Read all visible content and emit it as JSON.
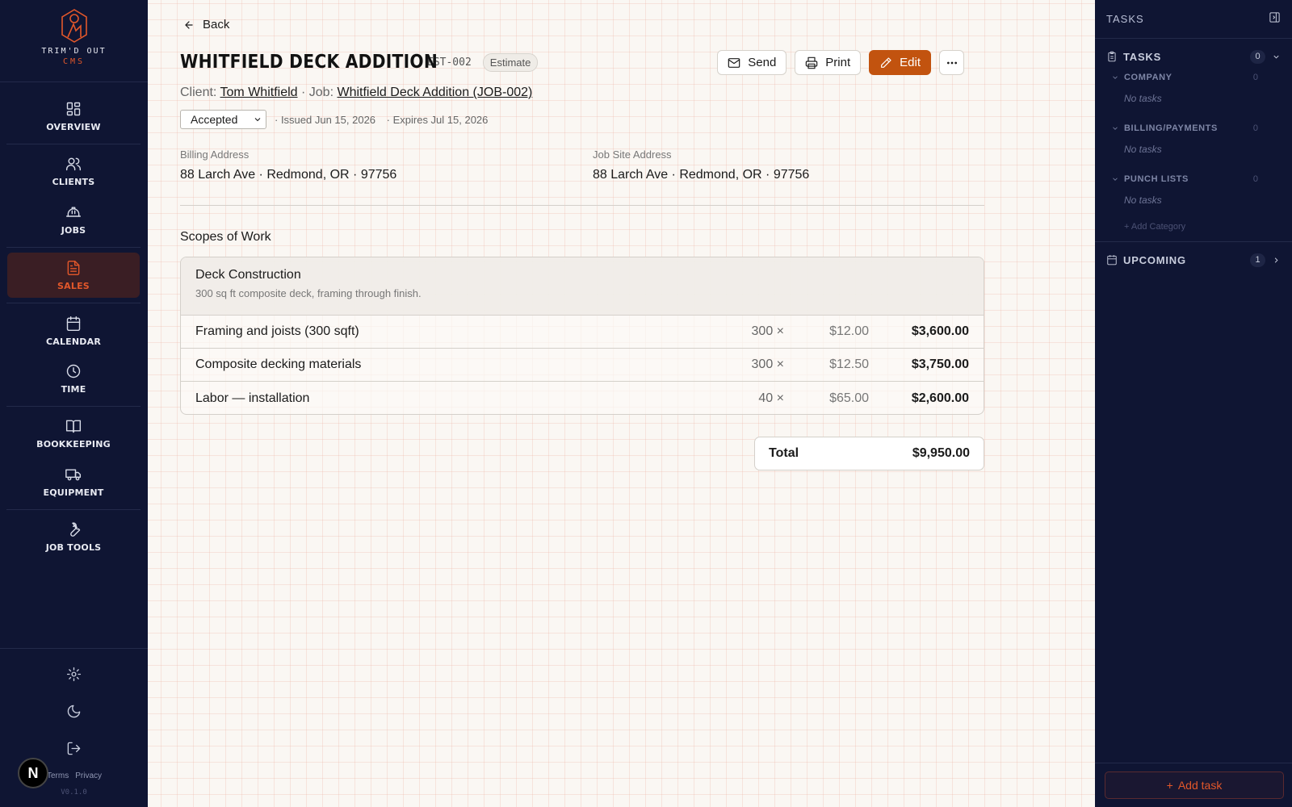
{
  "brand": {
    "name": "TRIM'D OUT",
    "sub": "CMS"
  },
  "nav": [
    {
      "id": "overview",
      "label": "OVERVIEW",
      "icon": "dashboard-icon"
    },
    {
      "id": "clients",
      "label": "CLIENTS",
      "icon": "users-icon"
    },
    {
      "id": "jobs",
      "label": "JOBS",
      "icon": "hard-hat-icon"
    },
    {
      "id": "sales",
      "label": "SALES",
      "icon": "document-icon",
      "active": true
    },
    {
      "id": "calendar",
      "label": "CALENDAR",
      "icon": "calendar-icon"
    },
    {
      "id": "time",
      "label": "TIME",
      "icon": "clock-icon"
    },
    {
      "id": "bookkeeping",
      "label": "BOOKKEEPING",
      "icon": "book-icon"
    },
    {
      "id": "equipment",
      "label": "EQUIPMENT",
      "icon": "truck-icon"
    },
    {
      "id": "jobtools",
      "label": "JOB TOOLS",
      "icon": "wrench-icon"
    }
  ],
  "footer": {
    "terms": "Terms",
    "privacy": "Privacy",
    "version": "V0.1.0",
    "badge": "N"
  },
  "header": {
    "back": "Back",
    "title": "WHITFIELD DECK ADDITION",
    "estimate_id": "EST-002",
    "type_badge": "Estimate",
    "actions": {
      "send": "Send",
      "print": "Print",
      "edit": "Edit"
    },
    "client_label": "Client:",
    "client_name": "Tom Whitfield",
    "job_sep": " · Job:",
    "job_name": "Whitfield Deck Addition (JOB-002)",
    "status": "Accepted",
    "issued": "· Issued Jun 15, 2026",
    "expires": "· Expires Jul 15, 2026"
  },
  "addresses": {
    "billing_label": "Billing Address",
    "billing_value": "88 Larch Ave · Redmond, OR · 97756",
    "site_label": "Job Site Address",
    "site_value": "88 Larch Ave · Redmond, OR · 97756"
  },
  "scopes": {
    "title": "Scopes of Work",
    "items": [
      {
        "name": "Deck Construction",
        "description": "300 sq ft composite deck, framing through finish.",
        "lines": [
          {
            "desc": "Framing and joists (300 sqft)",
            "qty": "300 ×",
            "rate": "$12.00",
            "amount": "$3,600.00"
          },
          {
            "desc": "Composite decking materials",
            "qty": "300 ×",
            "rate": "$12.50",
            "amount": "$3,750.00"
          },
          {
            "desc": "Labor — installation",
            "qty": "40 ×",
            "rate": "$65.00",
            "amount": "$2,600.00"
          }
        ]
      }
    ]
  },
  "total": {
    "label": "Total",
    "value": "$9,950.00"
  },
  "tasks_panel": {
    "title": "TASKS",
    "tasks_section": {
      "label": "TASKS",
      "count": "0"
    },
    "categories": [
      {
        "name": "COMPANY",
        "count": "0",
        "empty": "No tasks"
      },
      {
        "name": "BILLING/PAYMENTS",
        "count": "0",
        "empty": "No tasks"
      },
      {
        "name": "PUNCH LISTS",
        "count": "0",
        "empty": "No tasks"
      }
    ],
    "add_category": "+ Add Category",
    "upcoming": {
      "label": "UPCOMING",
      "count": "1"
    },
    "add_task": "Add task"
  },
  "colors": {
    "nav_bg": "#0f1533",
    "accent": "#e2572a",
    "edit_button": "#c2530f"
  }
}
